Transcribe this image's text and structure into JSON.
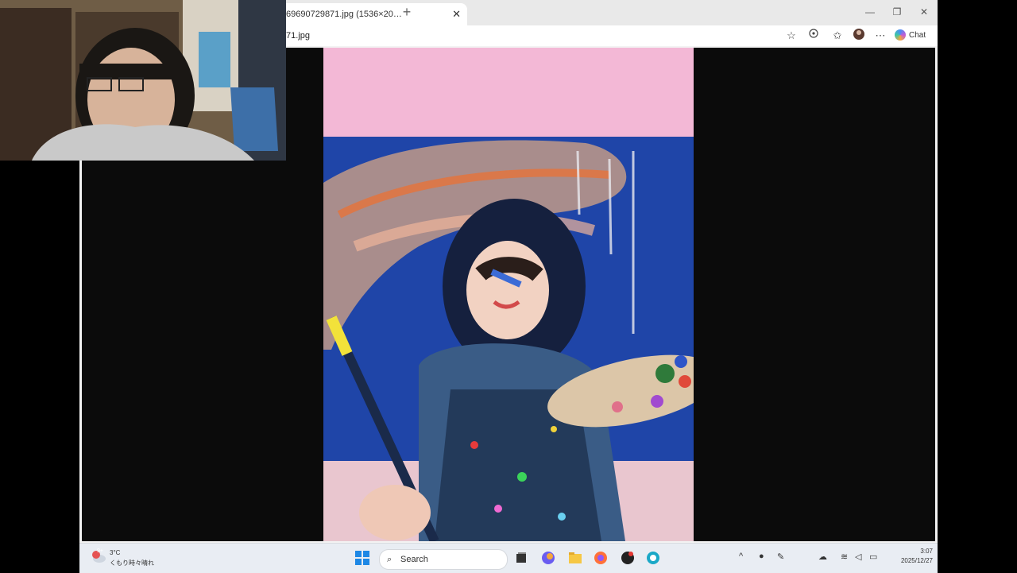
{
  "browser": {
    "tab_title": "69690729871.jpg (1536×20…",
    "tab_close": "✕",
    "new_tab": "+",
    "address": "71.jpg",
    "chat_label": "Chat",
    "window_controls": [
      "—",
      "❐",
      "✕"
    ]
  },
  "taskbar": {
    "weather_temp": "3°C",
    "weather_desc": "くもり時々晴れ",
    "weather_badge": "9+",
    "search_label": "Search",
    "clock_time": "3:07",
    "clock_date": "2025/12/27"
  },
  "colors": {
    "photo_bg_pink": "#f3b8d6",
    "photo_wall_blue": "#1f45a8",
    "viewer_bg": "#0b0b0b"
  },
  "icons": [
    "star-icon",
    "extension-icon",
    "favorites-icon",
    "profile-icon",
    "more-icon",
    "copilot-icon",
    "windows-start-icon",
    "search-icon",
    "task-view-icon",
    "copilot-app-icon",
    "file-explorer-icon",
    "firefox-icon",
    "app-icon",
    "edge-icon"
  ]
}
